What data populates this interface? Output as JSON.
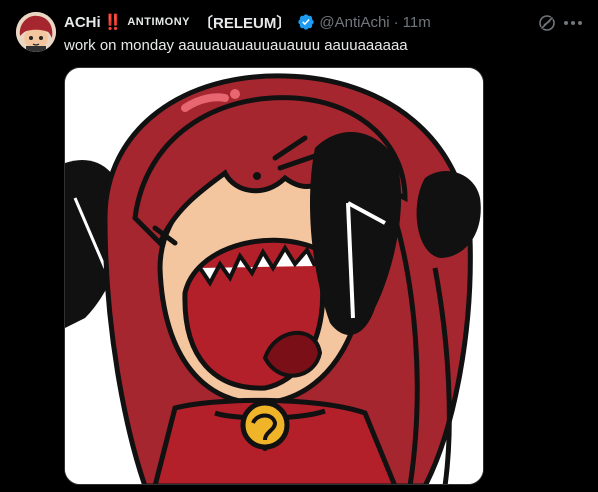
{
  "tweet": {
    "display_name": "ACHi",
    "bangs": "‼️",
    "affiliation_small": "ANTIMONY",
    "affiliation_tag": "〔RELEUM〕",
    "verified": true,
    "handle": "@AntiAchi",
    "separator": "·",
    "time": "11m",
    "text": "work on monday aauuauauauuauauuu aauuaaaaaa",
    "media_alt": "Cartoon of a red-haired character screaming, hands on head, with a gold bell collar"
  },
  "icons": {
    "grok": "grok-icon",
    "more": "more-icon",
    "verified": "verified-badge-icon"
  },
  "colors": {
    "background": "#000000",
    "text_primary": "#e7e9ea",
    "text_secondary": "#71767b",
    "verified_blue": "#1d9bf0",
    "bangs_red": "#f4212e",
    "hair_red": "#a6262f",
    "skin": "#f4c6a0",
    "bell_gold": "#f0b429"
  }
}
